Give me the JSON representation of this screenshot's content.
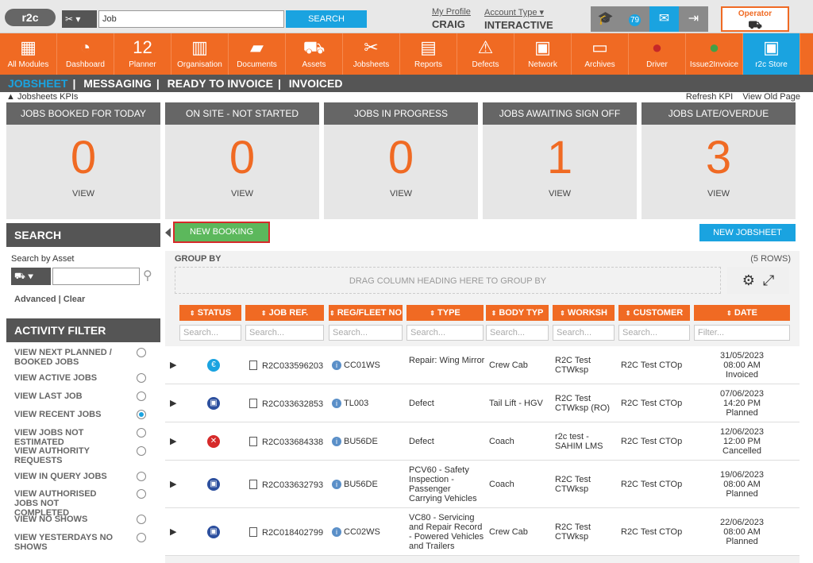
{
  "topbar": {
    "logo": "r2c",
    "search_value": "Job",
    "search_button": "SEARCH",
    "profile_label": "My Profile",
    "profile_name": "CRAIG",
    "account_label": "Account Type",
    "account_value": "INTERACTIVE",
    "notification_count": "79",
    "operator_label": "Operator"
  },
  "nav": [
    {
      "label": "All Modules",
      "icon": "grid-icon",
      "glyph": "▦"
    },
    {
      "label": "Dashboard",
      "icon": "gauge-icon",
      "glyph": "◔"
    },
    {
      "label": "Planner",
      "icon": "calendar-icon",
      "glyph": "12"
    },
    {
      "label": "Organisation",
      "icon": "building-icon",
      "glyph": "▥"
    },
    {
      "label": "Documents",
      "icon": "folder-icon",
      "glyph": "▰"
    },
    {
      "label": "Assets",
      "icon": "truck-icon",
      "glyph": "⛟"
    },
    {
      "label": "Jobsheets",
      "icon": "tools-icon",
      "glyph": "✂"
    },
    {
      "label": "Reports",
      "icon": "clipboard-icon",
      "glyph": "▤"
    },
    {
      "label": "Defects",
      "icon": "warning-icon",
      "glyph": "⚠"
    },
    {
      "label": "Network",
      "icon": "contacts-icon",
      "glyph": "▣"
    },
    {
      "label": "Archives",
      "icon": "archive-icon",
      "glyph": "▭"
    },
    {
      "label": "Driver",
      "icon": "driver-icon",
      "glyph": "●"
    },
    {
      "label": "Issue2Invoice",
      "icon": "i2i-icon",
      "glyph": "●"
    },
    {
      "label": "r2c Store",
      "icon": "briefcase-icon",
      "glyph": "▣"
    }
  ],
  "subnav": {
    "jobsheet": "JOBSHEET",
    "messaging": "MESSAGING",
    "ready": "READY TO INVOICE",
    "invoiced": "INVOICED",
    "sep": "|"
  },
  "kpi_bar": {
    "toggle": "Jobsheets KPIs",
    "refresh": "Refresh KPI",
    "old": "View Old Page"
  },
  "kpis": [
    {
      "title": "JOBS BOOKED FOR TODAY",
      "value": "0",
      "view": "VIEW"
    },
    {
      "title": "ON SITE - NOT STARTED",
      "value": "0",
      "view": "VIEW"
    },
    {
      "title": "JOBS IN PROGRESS",
      "value": "0",
      "view": "VIEW"
    },
    {
      "title": "JOBS AWAITING SIGN OFF",
      "value": "1",
      "view": "VIEW"
    },
    {
      "title": "JOBS LATE/OVERDUE",
      "value": "3",
      "view": "VIEW"
    }
  ],
  "search_panel": {
    "title": "SEARCH",
    "by_asset": "Search by Asset",
    "advanced": "Advanced",
    "clear": "Clear"
  },
  "activity": {
    "title": "ACTIVITY FILTER",
    "items": [
      {
        "label": "VIEW NEXT PLANNED / BOOKED JOBS",
        "selected": false
      },
      {
        "label": "VIEW ACTIVE JOBS",
        "selected": false
      },
      {
        "label": "VIEW LAST JOB",
        "selected": false
      },
      {
        "label": "VIEW RECENT JOBS",
        "selected": true
      },
      {
        "label": "VIEW JOBS NOT ESTIMATED",
        "selected": false
      },
      {
        "label": "VIEW AUTHORITY REQUESTS",
        "selected": false
      },
      {
        "label": "VIEW IN QUERY JOBS",
        "selected": false
      },
      {
        "label": "VIEW AUTHORISED JOBS NOT COMPLETED",
        "selected": false
      },
      {
        "label": "VIEW NO SHOWS",
        "selected": false
      },
      {
        "label": "VIEW YESTERDAYS NO SHOWS",
        "selected": false
      }
    ]
  },
  "actions": {
    "new_booking": "NEW BOOKING",
    "new_jobsheet": "NEW JOBSHEET"
  },
  "grid": {
    "group_by": "GROUP BY",
    "rows_count": "(5 ROWS)",
    "drag_hint": "DRAG COLUMN HEADING HERE TO GROUP BY",
    "columns": [
      "STATUS",
      "JOB REF.",
      "REG/FLEET NO",
      "TYPE",
      "BODY TYP",
      "WORKSH",
      "CUSTOMER",
      "DATE"
    ],
    "search_placeholder": "Search...",
    "filter_placeholder": "Filter...",
    "rows": [
      {
        "status": "invoiced",
        "job_ref": "R2C033596203",
        "reg": "CC01WS",
        "type": "Repair: Wing Mirror",
        "body": "Crew Cab",
        "workshop": "R2C Test CTWksp",
        "customer": "R2C Test CTOp",
        "date": "31/05/2023",
        "time": "08:00 AM",
        "state": "Invoiced"
      },
      {
        "status": "planned",
        "job_ref": "R2C033632853",
        "reg": "TL003",
        "type": "Defect",
        "body": "Tail Lift - HGV",
        "workshop": "R2C Test CTWksp (RO)",
        "customer": "R2C Test CTOp",
        "date": "07/06/2023",
        "time": "14:20 PM",
        "state": "Planned"
      },
      {
        "status": "cancelled",
        "job_ref": "R2C033684338",
        "reg": "BU56DE",
        "type": "Defect",
        "body": "Coach",
        "workshop": "r2c test - SAHIM LMS",
        "customer": "R2C Test CTOp",
        "date": "12/06/2023",
        "time": "12:00 PM",
        "state": "Cancelled"
      },
      {
        "status": "planned",
        "job_ref": "R2C033632793",
        "reg": "BU56DE",
        "type": "PCV60 - Safety Inspection - Passenger Carrying Vehicles",
        "body": "Coach",
        "workshop": "R2C Test CTWksp",
        "customer": "R2C Test CTOp",
        "date": "19/06/2023",
        "time": "08:00 AM",
        "state": "Planned"
      },
      {
        "status": "planned",
        "job_ref": "R2C018402799",
        "reg": "CC02WS",
        "type": "VC80 - Servicing and Repair Record - Powered Vehicles and Trailers",
        "body": "Crew Cab",
        "workshop": "R2C Test CTWksp",
        "customer": "R2C Test CTOp",
        "date": "22/06/2023",
        "time": "08:00 AM",
        "state": "Planned"
      }
    ]
  },
  "colors": {
    "brand": "#f06a23",
    "accent": "#1aa3e0",
    "dark": "#555555"
  }
}
